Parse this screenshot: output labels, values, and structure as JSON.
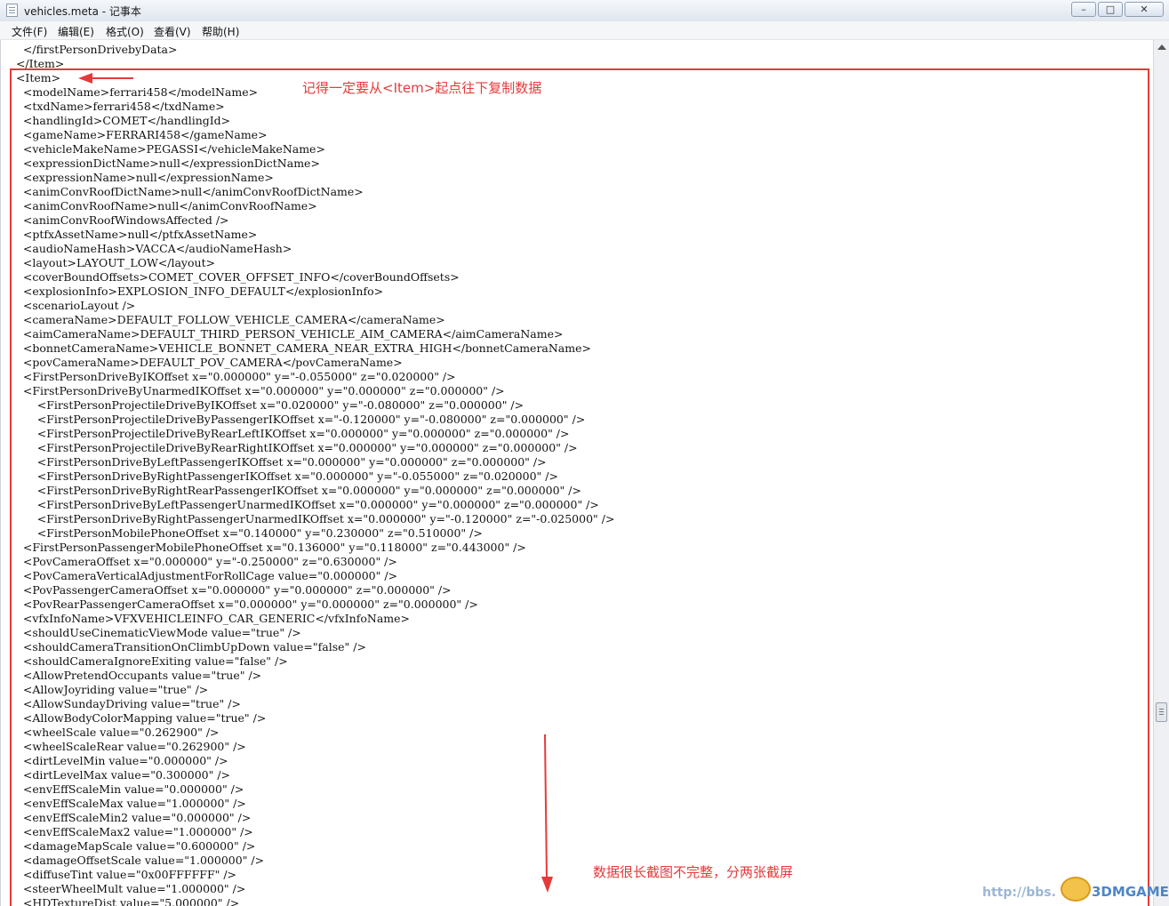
{
  "window": {
    "title": "vehicles.meta - 记事本",
    "minimize_symbol": "–",
    "maximize_symbol": "□",
    "close_symbol": "✕"
  },
  "menu": [
    "文件(F)",
    "编辑(E)",
    "格式(O)",
    "查看(V)",
    "帮助(H)"
  ],
  "lines": [
    "    </firstPersonDrivebyData>",
    "  </Item>",
    "  <Item>",
    "    <modelName>ferrari458</modelName>",
    "    <txdName>ferrari458</txdName>",
    "    <handlingId>COMET</handlingId>",
    "    <gameName>FERRARI458</gameName>",
    "    <vehicleMakeName>PEGASSI</vehicleMakeName>",
    "    <expressionDictName>null</expressionDictName>",
    "    <expressionName>null</expressionName>",
    "    <animConvRoofDictName>null</animConvRoofDictName>",
    "    <animConvRoofName>null</animConvRoofName>",
    "    <animConvRoofWindowsAffected />",
    "    <ptfxAssetName>null</ptfxAssetName>",
    "    <audioNameHash>VACCA</audioNameHash>",
    "    <layout>LAYOUT_LOW</layout>",
    "    <coverBoundOffsets>COMET_COVER_OFFSET_INFO</coverBoundOffsets>",
    "    <explosionInfo>EXPLOSION_INFO_DEFAULT</explosionInfo>",
    "    <scenarioLayout />",
    "    <cameraName>DEFAULT_FOLLOW_VEHICLE_CAMERA</cameraName>",
    "    <aimCameraName>DEFAULT_THIRD_PERSON_VEHICLE_AIM_CAMERA</aimCameraName>",
    "    <bonnetCameraName>VEHICLE_BONNET_CAMERA_NEAR_EXTRA_HIGH</bonnetCameraName>",
    "    <povCameraName>DEFAULT_POV_CAMERA</povCameraName>",
    "    <FirstPersonDriveByIKOffset x=\"0.000000\" y=\"-0.055000\" z=\"0.020000\" />",
    "    <FirstPersonDriveByUnarmedIKOffset x=\"0.000000\" y=\"0.000000\" z=\"0.000000\" />",
    "        <FirstPersonProjectileDriveByIKOffset x=\"0.020000\" y=\"-0.080000\" z=\"0.000000\" />",
    "        <FirstPersonProjectileDriveByPassengerIKOffset x=\"-0.120000\" y=\"-0.080000\" z=\"0.000000\" />",
    "        <FirstPersonProjectileDriveByRearLeftIKOffset x=\"0.000000\" y=\"0.000000\" z=\"0.000000\" />",
    "        <FirstPersonProjectileDriveByRearRightIKOffset x=\"0.000000\" y=\"0.000000\" z=\"0.000000\" />",
    "        <FirstPersonDriveByLeftPassengerIKOffset x=\"0.000000\" y=\"0.000000\" z=\"0.000000\" />",
    "        <FirstPersonDriveByRightPassengerIKOffset x=\"0.000000\" y=\"-0.055000\" z=\"0.020000\" />",
    "        <FirstPersonDriveByRightRearPassengerIKOffset x=\"0.000000\" y=\"0.000000\" z=\"0.000000\" />",
    "        <FirstPersonDriveByLeftPassengerUnarmedIKOffset x=\"0.000000\" y=\"0.000000\" z=\"0.000000\" />",
    "        <FirstPersonDriveByRightPassengerUnarmedIKOffset x=\"0.000000\" y=\"-0.120000\" z=\"-0.025000\" />",
    "        <FirstPersonMobilePhoneOffset x=\"0.140000\" y=\"0.230000\" z=\"0.510000\" />",
    "    <FirstPersonPassengerMobilePhoneOffset x=\"0.136000\" y=\"0.118000\" z=\"0.443000\" />",
    "    <PovCameraOffset x=\"0.000000\" y=\"-0.250000\" z=\"0.630000\" />",
    "    <PovCameraVerticalAdjustmentForRollCage value=\"0.000000\" />",
    "    <PovPassengerCameraOffset x=\"0.000000\" y=\"0.000000\" z=\"0.000000\" />",
    "    <PovRearPassengerCameraOffset x=\"0.000000\" y=\"0.000000\" z=\"0.000000\" />",
    "    <vfxInfoName>VFXVEHICLEINFO_CAR_GENERIC</vfxInfoName>",
    "    <shouldUseCinematicViewMode value=\"true\" />",
    "    <shouldCameraTransitionOnClimbUpDown value=\"false\" />",
    "    <shouldCameraIgnoreExiting value=\"false\" />",
    "    <AllowPretendOccupants value=\"true\" />",
    "    <AllowJoyriding value=\"true\" />",
    "    <AllowSundayDriving value=\"true\" />",
    "    <AllowBodyColorMapping value=\"true\" />",
    "    <wheelScale value=\"0.262900\" />",
    "    <wheelScaleRear value=\"0.262900\" />",
    "    <dirtLevelMin value=\"0.000000\" />",
    "    <dirtLevelMax value=\"0.300000\" />",
    "    <envEffScaleMin value=\"0.000000\" />",
    "    <envEffScaleMax value=\"1.000000\" />",
    "    <envEffScaleMin2 value=\"0.000000\" />",
    "    <envEffScaleMax2 value=\"1.000000\" />",
    "    <damageMapScale value=\"0.600000\" />",
    "    <damageOffsetScale value=\"1.000000\" />",
    "    <diffuseTint value=\"0x00FFFFFF\" />",
    "    <steerWheelMult value=\"1.000000\" />",
    "    <HDTextureDist value=\"5.000000\" />"
  ],
  "annotations": {
    "top_note": "记得一定要从<Item>起点往下复制数据",
    "bottom_note": "数据很长截图不完整，分两张截屏",
    "color": "#e53a3a"
  },
  "watermark": {
    "url": "http://bbs.",
    "logo": "3DMGAME"
  }
}
